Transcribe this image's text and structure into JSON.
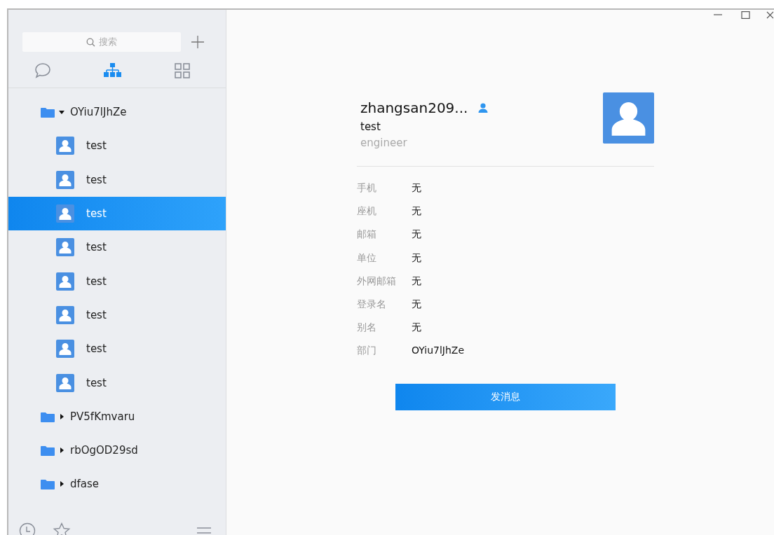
{
  "sidebar": {
    "search": {
      "placeholder": "搜索"
    },
    "tabs": [
      {
        "kind": "chat",
        "selected": false
      },
      {
        "kind": "org",
        "selected": true
      },
      {
        "kind": "apps",
        "selected": false
      }
    ],
    "tree": [
      {
        "label": "OYiu7lJhZe",
        "expanded": true,
        "selected": false,
        "children": [
          {
            "label": "test",
            "selected": false
          },
          {
            "label": "test",
            "selected": false
          },
          {
            "label": "test",
            "selected": true
          },
          {
            "label": "test",
            "selected": false
          },
          {
            "label": "test",
            "selected": false
          },
          {
            "label": "test",
            "selected": false
          },
          {
            "label": "test",
            "selected": false
          },
          {
            "label": "test",
            "selected": false
          }
        ]
      },
      {
        "label": "PV5fKmvaru",
        "expanded": false,
        "selected": false
      },
      {
        "label": "rbOgOD29sd",
        "expanded": false,
        "selected": false
      },
      {
        "label": "dfase",
        "expanded": false,
        "selected": false
      }
    ]
  },
  "profile": {
    "name": "zhangsan209...",
    "title": "test",
    "role": "engineer",
    "fields": [
      {
        "label": "手机",
        "value": "无"
      },
      {
        "label": "座机",
        "value": "无"
      },
      {
        "label": "邮箱",
        "value": "无"
      },
      {
        "label": "单位",
        "value": "无"
      },
      {
        "label": "外网邮箱",
        "value": "无"
      },
      {
        "label": "登录名",
        "value": "无"
      },
      {
        "label": "别名",
        "value": "无"
      },
      {
        "label": "部门",
        "value": "OYiu7lJhZe"
      }
    ],
    "button": "发消息"
  }
}
